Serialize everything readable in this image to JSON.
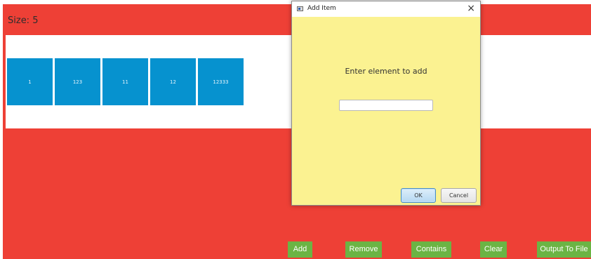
{
  "size": {
    "label": "Size:",
    "value": "5"
  },
  "list": {
    "items": [
      "1",
      "123",
      "11",
      "12",
      "12333"
    ]
  },
  "buttons": {
    "add": "Add",
    "remove": "Remove",
    "contains": "Contains",
    "clear": "Clear",
    "output": "Output To File"
  },
  "dialog": {
    "title": "Add Item",
    "close": "×",
    "prompt": "Enter element to add",
    "input_value": "",
    "ok": "OK",
    "cancel": "Cancel"
  },
  "colors": {
    "background": "#ee4036",
    "cell": "#0692cf",
    "button": "#6bb444",
    "dialog": "#fbf291"
  }
}
